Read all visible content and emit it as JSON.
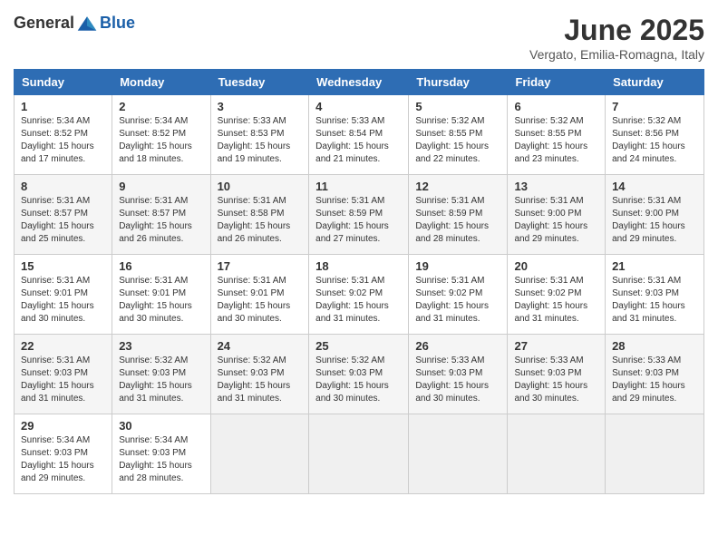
{
  "header": {
    "logo_general": "General",
    "logo_blue": "Blue",
    "month_title": "June 2025",
    "location": "Vergato, Emilia-Romagna, Italy"
  },
  "weekdays": [
    "Sunday",
    "Monday",
    "Tuesday",
    "Wednesday",
    "Thursday",
    "Friday",
    "Saturday"
  ],
  "weeks": [
    [
      {
        "day": "1",
        "info": "Sunrise: 5:34 AM\nSunset: 8:52 PM\nDaylight: 15 hours\nand 17 minutes."
      },
      {
        "day": "2",
        "info": "Sunrise: 5:34 AM\nSunset: 8:52 PM\nDaylight: 15 hours\nand 18 minutes."
      },
      {
        "day": "3",
        "info": "Sunrise: 5:33 AM\nSunset: 8:53 PM\nDaylight: 15 hours\nand 19 minutes."
      },
      {
        "day": "4",
        "info": "Sunrise: 5:33 AM\nSunset: 8:54 PM\nDaylight: 15 hours\nand 21 minutes."
      },
      {
        "day": "5",
        "info": "Sunrise: 5:32 AM\nSunset: 8:55 PM\nDaylight: 15 hours\nand 22 minutes."
      },
      {
        "day": "6",
        "info": "Sunrise: 5:32 AM\nSunset: 8:55 PM\nDaylight: 15 hours\nand 23 minutes."
      },
      {
        "day": "7",
        "info": "Sunrise: 5:32 AM\nSunset: 8:56 PM\nDaylight: 15 hours\nand 24 minutes."
      }
    ],
    [
      {
        "day": "8",
        "info": "Sunrise: 5:31 AM\nSunset: 8:57 PM\nDaylight: 15 hours\nand 25 minutes."
      },
      {
        "day": "9",
        "info": "Sunrise: 5:31 AM\nSunset: 8:57 PM\nDaylight: 15 hours\nand 26 minutes."
      },
      {
        "day": "10",
        "info": "Sunrise: 5:31 AM\nSunset: 8:58 PM\nDaylight: 15 hours\nand 26 minutes."
      },
      {
        "day": "11",
        "info": "Sunrise: 5:31 AM\nSunset: 8:59 PM\nDaylight: 15 hours\nand 27 minutes."
      },
      {
        "day": "12",
        "info": "Sunrise: 5:31 AM\nSunset: 8:59 PM\nDaylight: 15 hours\nand 28 minutes."
      },
      {
        "day": "13",
        "info": "Sunrise: 5:31 AM\nSunset: 9:00 PM\nDaylight: 15 hours\nand 29 minutes."
      },
      {
        "day": "14",
        "info": "Sunrise: 5:31 AM\nSunset: 9:00 PM\nDaylight: 15 hours\nand 29 minutes."
      }
    ],
    [
      {
        "day": "15",
        "info": "Sunrise: 5:31 AM\nSunset: 9:01 PM\nDaylight: 15 hours\nand 30 minutes."
      },
      {
        "day": "16",
        "info": "Sunrise: 5:31 AM\nSunset: 9:01 PM\nDaylight: 15 hours\nand 30 minutes."
      },
      {
        "day": "17",
        "info": "Sunrise: 5:31 AM\nSunset: 9:01 PM\nDaylight: 15 hours\nand 30 minutes."
      },
      {
        "day": "18",
        "info": "Sunrise: 5:31 AM\nSunset: 9:02 PM\nDaylight: 15 hours\nand 31 minutes."
      },
      {
        "day": "19",
        "info": "Sunrise: 5:31 AM\nSunset: 9:02 PM\nDaylight: 15 hours\nand 31 minutes."
      },
      {
        "day": "20",
        "info": "Sunrise: 5:31 AM\nSunset: 9:02 PM\nDaylight: 15 hours\nand 31 minutes."
      },
      {
        "day": "21",
        "info": "Sunrise: 5:31 AM\nSunset: 9:03 PM\nDaylight: 15 hours\nand 31 minutes."
      }
    ],
    [
      {
        "day": "22",
        "info": "Sunrise: 5:31 AM\nSunset: 9:03 PM\nDaylight: 15 hours\nand 31 minutes."
      },
      {
        "day": "23",
        "info": "Sunrise: 5:32 AM\nSunset: 9:03 PM\nDaylight: 15 hours\nand 31 minutes."
      },
      {
        "day": "24",
        "info": "Sunrise: 5:32 AM\nSunset: 9:03 PM\nDaylight: 15 hours\nand 31 minutes."
      },
      {
        "day": "25",
        "info": "Sunrise: 5:32 AM\nSunset: 9:03 PM\nDaylight: 15 hours\nand 30 minutes."
      },
      {
        "day": "26",
        "info": "Sunrise: 5:33 AM\nSunset: 9:03 PM\nDaylight: 15 hours\nand 30 minutes."
      },
      {
        "day": "27",
        "info": "Sunrise: 5:33 AM\nSunset: 9:03 PM\nDaylight: 15 hours\nand 30 minutes."
      },
      {
        "day": "28",
        "info": "Sunrise: 5:33 AM\nSunset: 9:03 PM\nDaylight: 15 hours\nand 29 minutes."
      }
    ],
    [
      {
        "day": "29",
        "info": "Sunrise: 5:34 AM\nSunset: 9:03 PM\nDaylight: 15 hours\nand 29 minutes."
      },
      {
        "day": "30",
        "info": "Sunrise: 5:34 AM\nSunset: 9:03 PM\nDaylight: 15 hours\nand 28 minutes."
      },
      null,
      null,
      null,
      null,
      null
    ]
  ]
}
